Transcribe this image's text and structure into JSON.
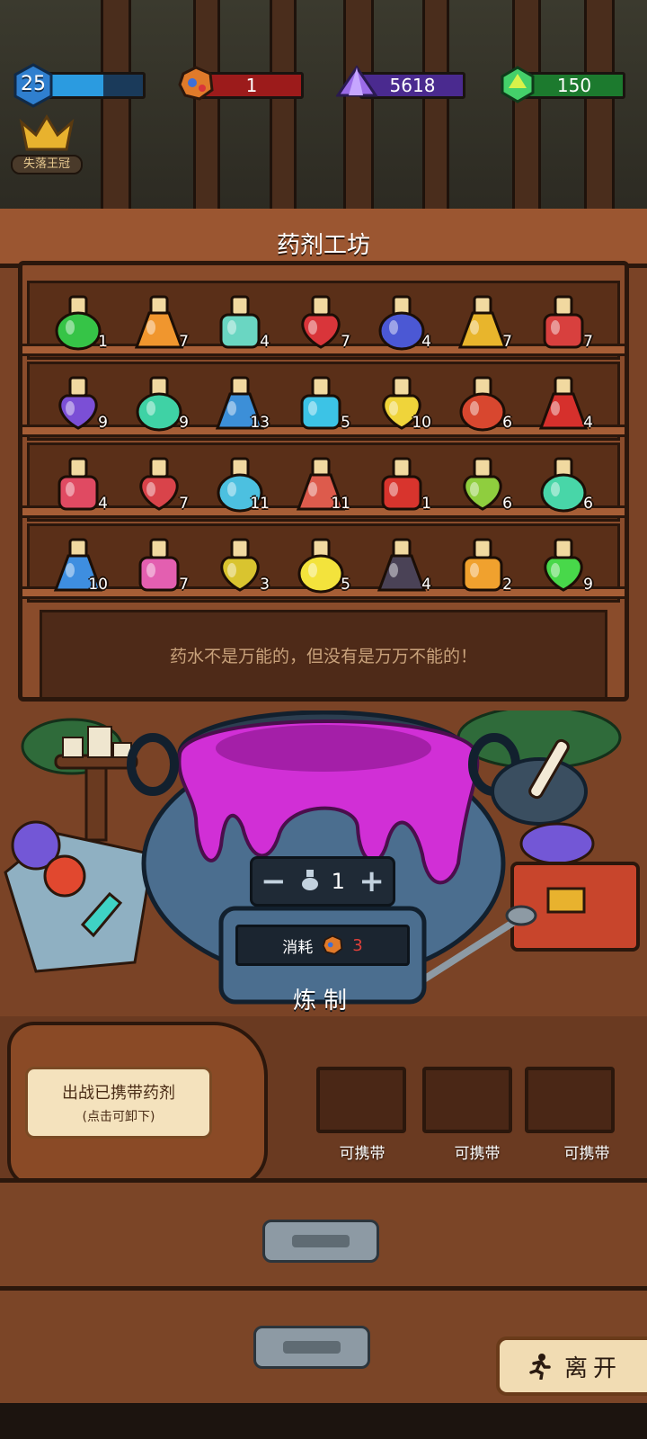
{
  "hud": {
    "level": "25",
    "level_progress": 0.58,
    "ore": "1",
    "crystal": "5618",
    "gem": "150",
    "colors": {
      "xp": "#2b9be0",
      "ore": "#9c1b1b",
      "crystal": "#4a2a8f",
      "gem": "#1c7a2e"
    }
  },
  "crown": {
    "label": "失落王冠"
  },
  "title": "药剂工坊",
  "shelves": [
    {
      "potions": [
        {
          "icon": "green-gem-potion-icon",
          "color": "#36c447",
          "count": "1"
        },
        {
          "icon": "orange-potion-icon",
          "color": "#f0962e",
          "count": "7"
        },
        {
          "icon": "rainbow-jar-potion-icon",
          "color": "#6ad6c2",
          "count": "4"
        },
        {
          "icon": "red-round-potion-icon",
          "color": "#d9353a",
          "count": "7"
        },
        {
          "icon": "blue-flask-potion-icon",
          "color": "#4b58d4",
          "count": "4"
        },
        {
          "icon": "yellow-potion-icon",
          "color": "#e8b52c",
          "count": "7"
        },
        {
          "icon": "red-jar-potion-icon",
          "color": "#d8403e",
          "count": "7"
        }
      ]
    },
    {
      "potions": [
        {
          "icon": "purple-jar-potion-icon",
          "color": "#7b4fd6",
          "count": "9"
        },
        {
          "icon": "teal-flask-potion-icon",
          "color": "#3fd2a5",
          "count": "9"
        },
        {
          "icon": "blue-vase-potion-icon",
          "color": "#3c8fd8",
          "count": "13"
        },
        {
          "icon": "cyan-cube-potion-icon",
          "color": "#3cc3e6",
          "count": "5"
        },
        {
          "icon": "yellow-flask-potion-icon",
          "color": "#efd43a",
          "count": "10"
        },
        {
          "icon": "red-crown-potion-icon",
          "color": "#d8472f",
          "count": "6"
        },
        {
          "icon": "red-cone-potion-icon",
          "color": "#d6302c",
          "count": "4"
        }
      ]
    },
    {
      "potions": [
        {
          "icon": "pink-tilted-potion-icon",
          "color": "#e04a62",
          "count": "4"
        },
        {
          "icon": "red-flat-potion-icon",
          "color": "#d9434a",
          "count": "7"
        },
        {
          "icon": "sky-round-potion-icon",
          "color": "#4cc0e0",
          "count": "11"
        },
        {
          "icon": "salmon-potion-icon",
          "color": "#dd5b4c",
          "count": "11"
        },
        {
          "icon": "red-gold-potion-icon",
          "color": "#d8342d",
          "count": "1"
        },
        {
          "icon": "rainbow-bottle-potion-icon",
          "color": "#8fce3e",
          "count": "6"
        },
        {
          "icon": "mint-sprout-potion-icon",
          "color": "#48d6a8",
          "count": "6"
        }
      ]
    },
    {
      "potions": [
        {
          "icon": "blue-crown-potion-icon",
          "color": "#3e8ee0",
          "count": "10"
        },
        {
          "icon": "pink-square-potion-icon",
          "color": "#e35fb0",
          "count": "7"
        },
        {
          "icon": "yellow-sprout-potion-icon",
          "color": "#d9c42f",
          "count": "3"
        },
        {
          "icon": "lemon-potion-icon",
          "color": "#f3e33c",
          "count": "5"
        },
        {
          "icon": "dark-diamond-potion-icon",
          "color": "#4a4256",
          "count": "4"
        },
        {
          "icon": "amber-jar-potion-icon",
          "color": "#f0a12e",
          "count": "2"
        },
        {
          "icon": "green-heart-potion-icon",
          "color": "#48d84a",
          "count": "9"
        }
      ]
    }
  ],
  "message": "药水不是万能的，但没有是万万不能的！",
  "brew": {
    "minus": "−",
    "quantity": "1",
    "plus": "+",
    "cost_label": "消耗",
    "cost_value": "3",
    "brew_label": "炼制",
    "cauldron_color": "#d12fd6"
  },
  "carry": {
    "note_main": "出战已携带药剂",
    "note_sub": "(点击可卸下)",
    "slots": [
      "可携带",
      "可携带",
      "可携带"
    ]
  },
  "leave_label": "离开"
}
